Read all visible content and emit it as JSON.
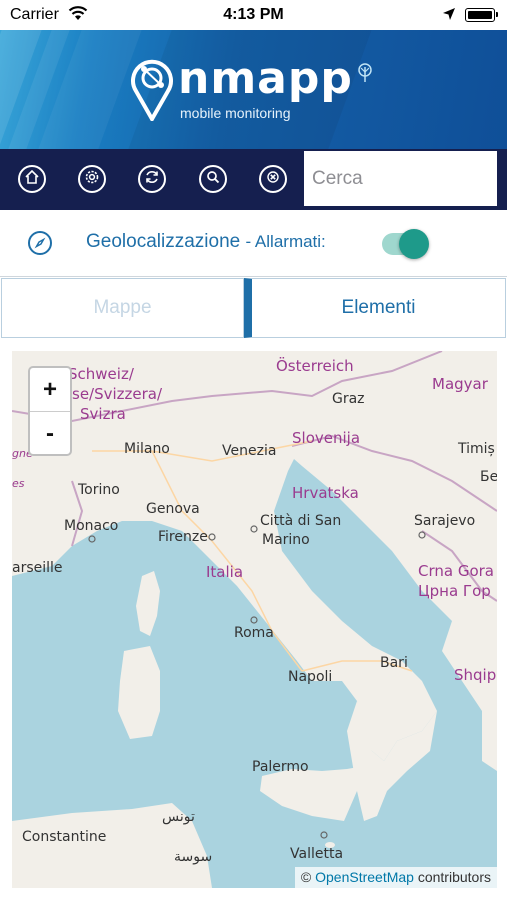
{
  "status_bar": {
    "carrier": "Carrier",
    "time": "4:13 PM"
  },
  "header": {
    "logo_text": "nmapp",
    "logo_subtitle": "mobile monitoring"
  },
  "toolbar": {
    "buttons": [
      {
        "icon": "home-icon"
      },
      {
        "icon": "settings-icon"
      },
      {
        "icon": "refresh-icon"
      },
      {
        "icon": "search-icon"
      },
      {
        "icon": "close-icon"
      }
    ],
    "search_placeholder": "Cerca"
  },
  "geo": {
    "label": "Geolocalizzazione",
    "sublabel": "- Allarmati:",
    "toggle_on": true,
    "accent": "#1f6fa8",
    "toggle_color": "#1e9a8a"
  },
  "tabs": [
    {
      "label": "Mappe",
      "active": false
    },
    {
      "label": "Elementi",
      "active": true
    }
  ],
  "map": {
    "zoom_in": "+",
    "zoom_out": "-",
    "attribution_prefix": "©",
    "attribution_link": "OpenStreetMap",
    "attribution_suffix": "contributors",
    "labels": {
      "osterreich": "Österreich",
      "magyar": "Magyar",
      "schweiz": "Schweiz/",
      "suisse": "se/Svizzera/",
      "svizra": "Svizra",
      "graz": "Graz",
      "slovenija": "Slovenija",
      "milano": "Milano",
      "venezia": "Venezia",
      "timis": "Timiș",
      "hrvatska": "Hrvatska",
      "torino": "Torino",
      "genova": "Genova",
      "monaco": "Monaco",
      "firenze": "Firenze",
      "citta": "Città di San",
      "marino": "Marino",
      "sarajevo": "Sarajevo",
      "crna": "Crna Gora",
      "crna_cyr": "Црна Гор",
      "arseille": "arseille",
      "italia": "Italia",
      "roma": "Roma",
      "bari": "Bari",
      "napoli": "Napoli",
      "shqip": "Shqip",
      "palermo": "Palermo",
      "constantine": "Constantine",
      "tunis": "تونس",
      "sousse": "سوسة",
      "valletta": "Valletta",
      "be": "Бе",
      "gne": "gne",
      "es": "es"
    }
  }
}
